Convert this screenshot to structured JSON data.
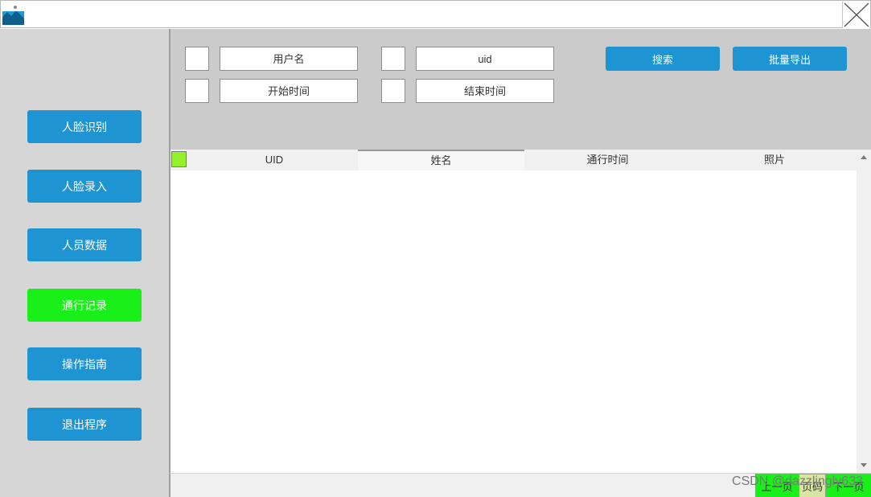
{
  "nav": [
    {
      "id": "face-recognition",
      "label": "人脸识别",
      "active": false
    },
    {
      "id": "face-enroll",
      "label": "人脸录入",
      "active": false
    },
    {
      "id": "personnel-data",
      "label": "人员数据",
      "active": false
    },
    {
      "id": "access-records",
      "label": "通行记录",
      "active": true
    },
    {
      "id": "operation-guide",
      "label": "操作指南",
      "active": false
    },
    {
      "id": "exit-program",
      "label": "退出程序",
      "active": false
    }
  ],
  "filters": {
    "username_placeholder": "用户名",
    "uid_placeholder": "uid",
    "start_time_placeholder": "开始时间",
    "end_time_placeholder": "结束时间"
  },
  "actions": {
    "search_label": "搜索",
    "export_label": "批量导出"
  },
  "table": {
    "columns": [
      "UID",
      "姓名",
      "通行时间",
      "照片"
    ],
    "rows": []
  },
  "pager": {
    "first_label": "上一页",
    "page_label": "页码",
    "next_label": "下一页"
  },
  "watermark": "CSDN @dazzlingly633",
  "colors": {
    "nav_button": "#1f94d2",
    "nav_active": "#19f019",
    "sidebar_bg": "#d6d6d6",
    "filter_bg": "#cbcbcb",
    "header_check": "#93f02a"
  },
  "icons": {
    "app": "app-logo-icon",
    "close": "close-icon"
  }
}
